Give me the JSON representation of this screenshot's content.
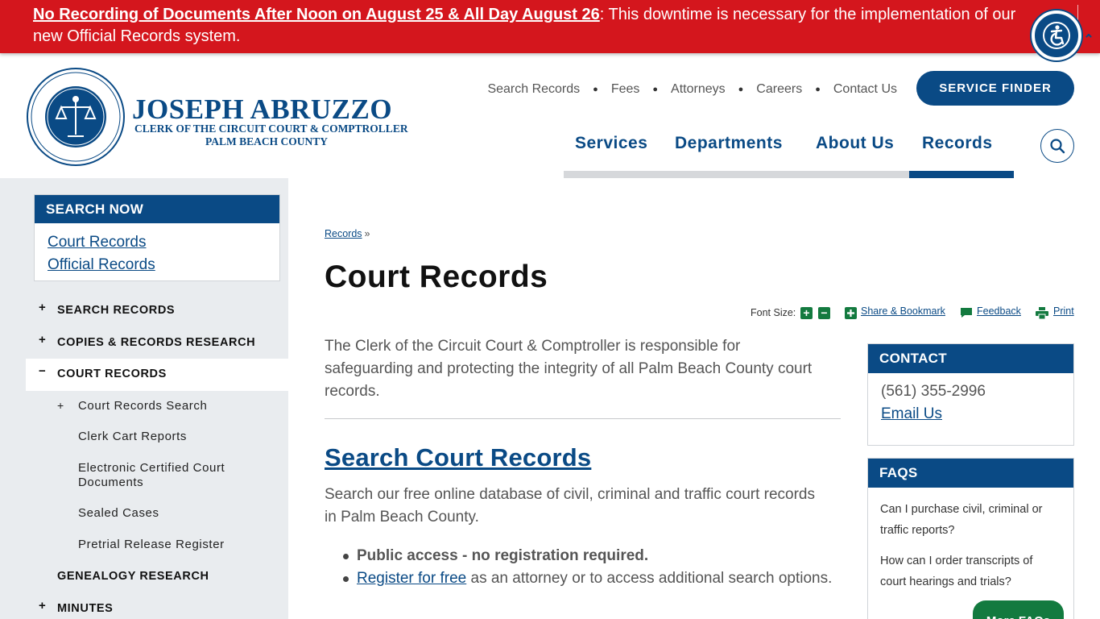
{
  "alert": {
    "link_text": "No Recording of Documents After Noon on August 25 & All Day August 26",
    "rest_text": ": This downtime is necessary for the implementation of our new Official Records system."
  },
  "brand": {
    "name": "JOSEPH ABRUZZO",
    "subtitle1": "CLERK OF THE CIRCUIT COURT & COMPTROLLER",
    "subtitle2": "PALM BEACH COUNTY"
  },
  "utility_nav": [
    "Search Records",
    "Fees",
    "Attorneys",
    "Careers",
    "Contact Us"
  ],
  "service_finder": "SERVICE FINDER",
  "main_nav": [
    {
      "label": "Services"
    },
    {
      "label": "Departments"
    },
    {
      "label": "About Us"
    },
    {
      "label": "Records",
      "active": true
    }
  ],
  "sidebar": {
    "search_now": {
      "title": "SEARCH NOW",
      "links": [
        "Court Records",
        "Official Records"
      ]
    },
    "nav": [
      {
        "sign": "+",
        "label": "SEARCH RECORDS"
      },
      {
        "sign": "+",
        "label": "COPIES & RECORDS RESEARCH"
      },
      {
        "sign": "−",
        "label": "COURT RECORDS",
        "active": true
      },
      {
        "sign": "",
        "label": "GENEALOGY RESEARCH"
      },
      {
        "sign": "+",
        "label": "MINUTES"
      }
    ],
    "sub_items": [
      {
        "sign": "+",
        "label": "Court Records Search"
      },
      {
        "sign": "",
        "label": "Clerk Cart Reports"
      },
      {
        "sign": "",
        "label": "Electronic Certified Court Documents"
      },
      {
        "sign": "",
        "label": "Sealed Cases"
      },
      {
        "sign": "",
        "label": "Pretrial Release Register"
      }
    ]
  },
  "breadcrumb": {
    "link": "Records",
    "separator": "»"
  },
  "page_title": "Court Records",
  "tools": {
    "font_size": "Font Size:",
    "increase": "+",
    "decrease": "−",
    "share": "Share & Bookmark",
    "feedback": "Feedback",
    "print": "Print"
  },
  "intro": "The Clerk of the Circuit Court & Comptroller is responsible for safeguarding and protecting the integrity of all Palm Beach County court records.",
  "section": {
    "heading": "Search Court Records",
    "text": "Search our free online database of civil, criminal and traffic court records in Palm Beach County.",
    "bullet1_bold": "Public access - no registration required.",
    "bullet2_link": "Register for free",
    "bullet2_rest": " as an attorney or to access additional search options."
  },
  "contact": {
    "title": "CONTACT",
    "phone": "(561) 355-2996",
    "email": "Email Us"
  },
  "faqs": {
    "title": "FAQS",
    "items": [
      "Can I purchase civil, criminal or traffic reports?",
      "How can I order transcripts of court hearings and trials?"
    ],
    "more": "More FAQs"
  },
  "colors": {
    "brand_blue": "#0a4a85",
    "alert_red": "#d4161d",
    "green": "#137a3f",
    "sidebar_bg": "#e9ecef"
  }
}
